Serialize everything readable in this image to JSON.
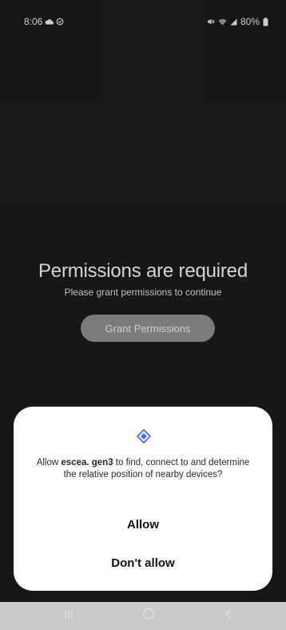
{
  "status_bar": {
    "time": "8:06",
    "battery": "80%"
  },
  "main": {
    "title": "Permissions are required",
    "subtitle": "Please grant permissions to continue",
    "grant_button_label": "Grant Permissions"
  },
  "dialog": {
    "message_prefix": "Allow ",
    "app_name": "escea. gen3",
    "message_suffix": " to find, connect to and determine the relative position of nearby devices?",
    "allow_label": "Allow",
    "deny_label": "Don't allow",
    "icon": "nearby-devices-icon",
    "icon_color": "#4a6cf0"
  },
  "nav_bar": {
    "recents_icon": "recents-icon",
    "home_icon": "home-icon",
    "back_icon": "back-icon"
  },
  "colors": {
    "background": "#1b1b1d",
    "button": "#8d8d8f",
    "dialog": "#ffffff",
    "nav_bar": "#c9c9cb"
  }
}
